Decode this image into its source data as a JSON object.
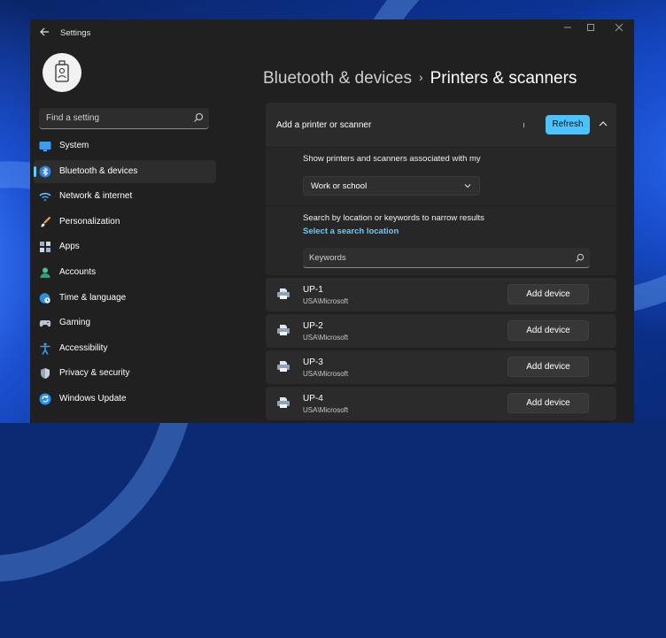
{
  "app": {
    "title": "Settings"
  },
  "search": {
    "placeholder": "Find a setting"
  },
  "nav": {
    "items": [
      {
        "label": "System",
        "icon": "monitor-icon"
      },
      {
        "label": "Bluetooth & devices",
        "icon": "bluetooth-icon",
        "active": true
      },
      {
        "label": "Network & internet",
        "icon": "wifi-icon"
      },
      {
        "label": "Personalization",
        "icon": "paintbrush-icon"
      },
      {
        "label": "Apps",
        "icon": "apps-icon"
      },
      {
        "label": "Accounts",
        "icon": "person-icon"
      },
      {
        "label": "Time & language",
        "icon": "globe-clock-icon"
      },
      {
        "label": "Gaming",
        "icon": "gamepad-icon"
      },
      {
        "label": "Accessibility",
        "icon": "accessibility-icon"
      },
      {
        "label": "Privacy & security",
        "icon": "shield-icon"
      },
      {
        "label": "Windows Update",
        "icon": "update-icon"
      }
    ]
  },
  "breadcrumb": {
    "parent": "Bluetooth & devices",
    "separator": "›",
    "current": "Printers & scanners"
  },
  "add_section": {
    "title": "Add a printer or scanner",
    "refresh_label": "Refresh",
    "show_label": "Show printers and scanners associated with my",
    "dropdown_value": "Work or school",
    "search_desc": "Search by location or keywords to narrow results",
    "location_link": "Select a search location",
    "keywords_placeholder": "Keywords"
  },
  "devices": [
    {
      "name": "UP-1",
      "location": "USA\\Microsoft",
      "action": "Add device"
    },
    {
      "name": "UP-2",
      "location": "USA\\Microsoft",
      "action": "Add device"
    },
    {
      "name": "UP-3",
      "location": "USA\\Microsoft",
      "action": "Add device"
    },
    {
      "name": "UP-4",
      "location": "USA\\Microsoft",
      "action": "Add device"
    }
  ],
  "colors": {
    "accent": "#4cc2ff",
    "link": "#60cdff",
    "window_bg": "#202020",
    "card_bg": "#2b2b2b"
  }
}
